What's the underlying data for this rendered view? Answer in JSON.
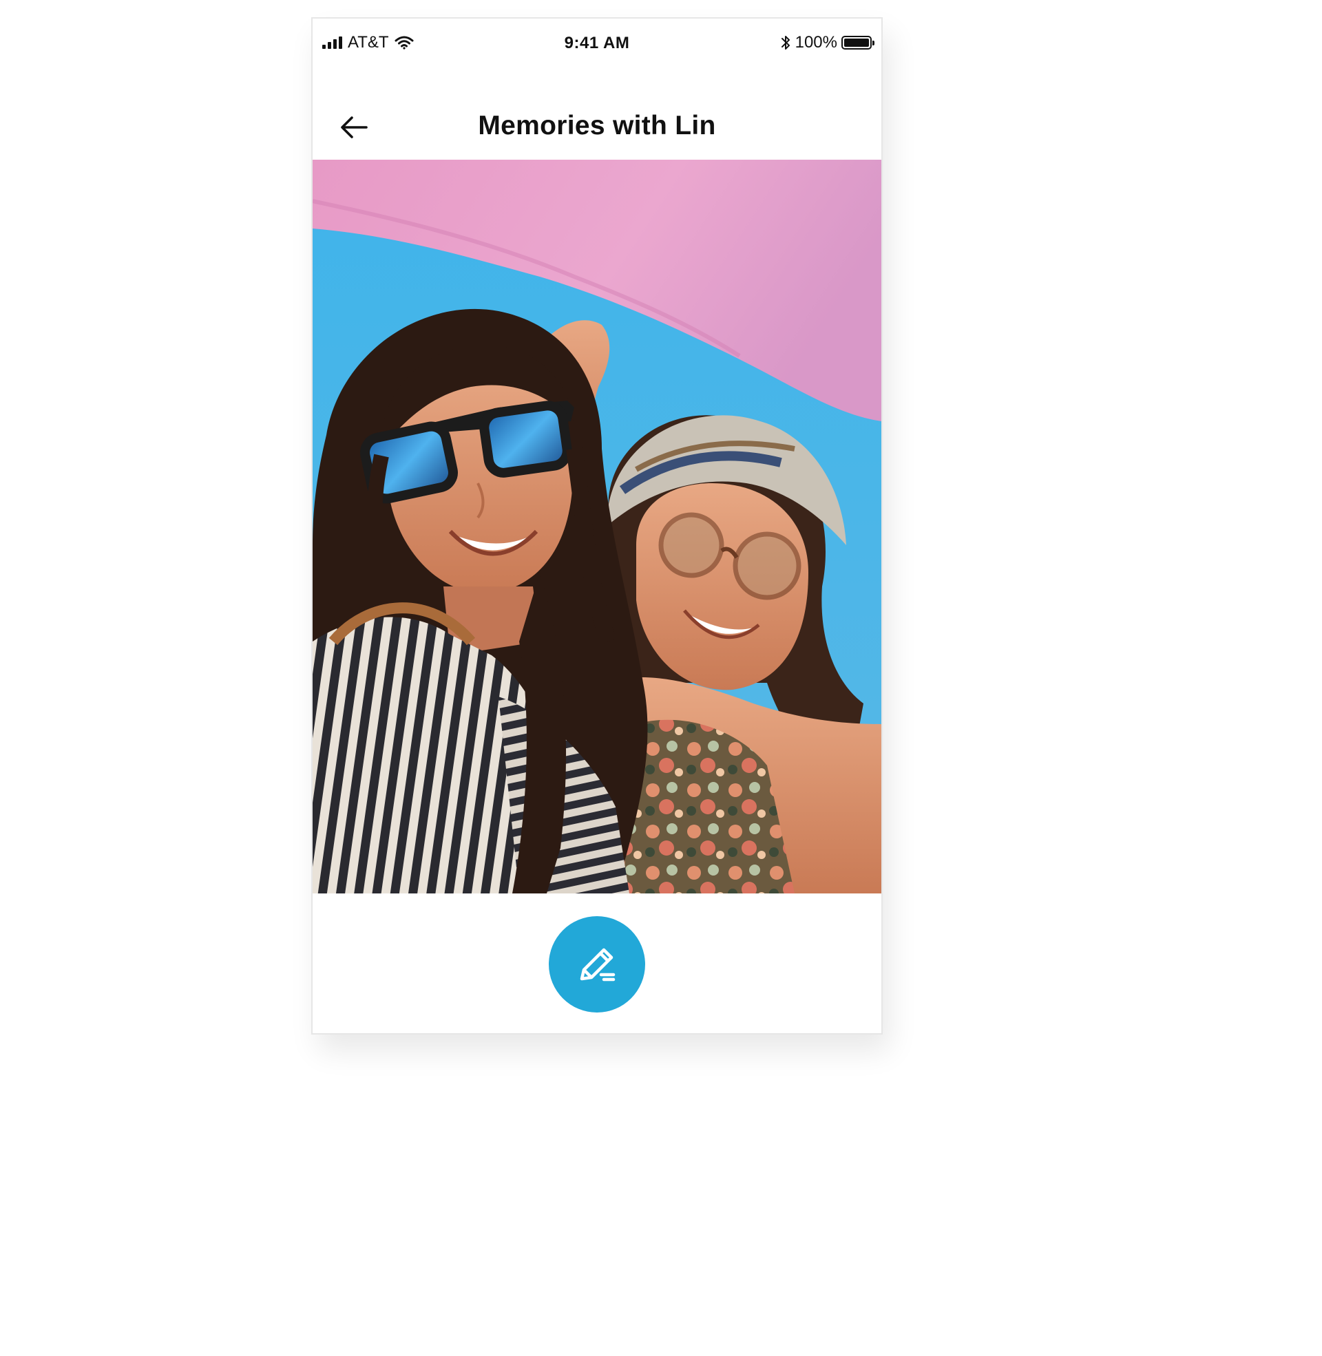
{
  "status_bar": {
    "carrier": "AT&T",
    "time": "9:41 AM",
    "battery_percent_label": "100%",
    "battery_level": 1.0
  },
  "header": {
    "title": "Memories with Lin",
    "back_icon": "arrow-left-icon"
  },
  "photo": {
    "description_icon": "photo"
  },
  "fab": {
    "icon": "edit-pencil-icon",
    "color": "#22a8d8"
  }
}
